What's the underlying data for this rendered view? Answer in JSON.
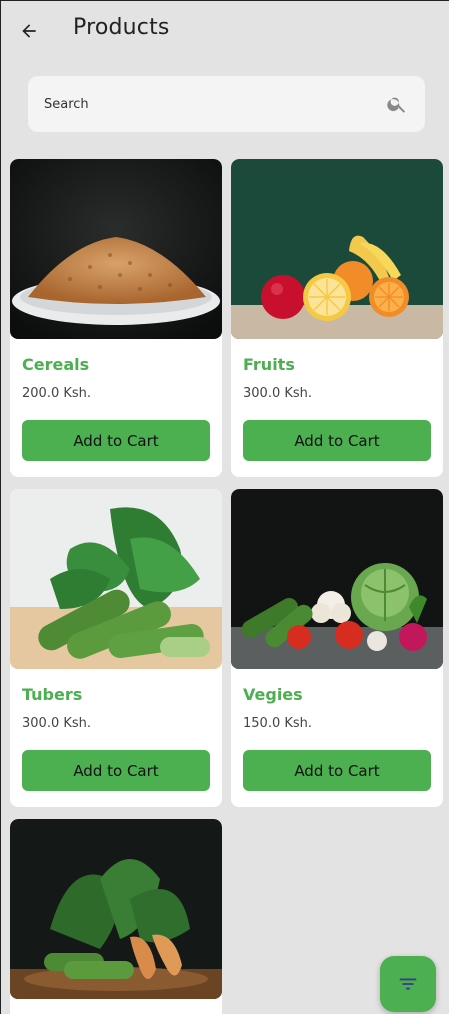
{
  "header": {
    "title": "Products",
    "back_icon": "arrow-back-icon"
  },
  "search": {
    "placeholder": "Search",
    "icon": "search-icon"
  },
  "products": [
    {
      "name": "Cereals",
      "price": "200.0 Ksh.",
      "button": "Add to Cart"
    },
    {
      "name": "Fruits",
      "price": "300.0 Ksh.",
      "button": "Add to Cart"
    },
    {
      "name": "Tubers",
      "price": "300.0 Ksh.",
      "button": "Add to Cart"
    },
    {
      "name": "Vegies",
      "price": "150.0 Ksh.",
      "button": "Add to Cart"
    }
  ],
  "fab": {
    "icon": "filter-icon"
  },
  "colors": {
    "accent": "#4caf50",
    "background": "#e3e3e3"
  }
}
